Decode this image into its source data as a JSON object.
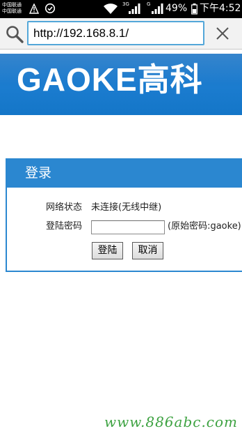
{
  "status_bar": {
    "carrier_line1": "中国联通",
    "carrier_line2": "中国联通",
    "network_3g": "3G",
    "network_g": "G",
    "battery": "49%",
    "time": "下午4:52"
  },
  "browser": {
    "url": "http://192.168.8.1/",
    "icons": [
      "search-icon",
      "close-icon"
    ]
  },
  "banner": {
    "logo_text": "GAOKE高科"
  },
  "login": {
    "title": "登录",
    "network_status_label": "网络状态",
    "network_status_value": "未连接(无线中继)",
    "password_label": "登陆密码",
    "password_value": "",
    "password_hint": "(原始密码:gaoke)",
    "login_button": "登陆",
    "cancel_button": "取消"
  },
  "watermark": "www.886abc.com",
  "colors": {
    "accent": "#2b87d0",
    "banner": "#1b7ccf",
    "url_border": "#53a7d9",
    "watermark": "#3da241"
  }
}
